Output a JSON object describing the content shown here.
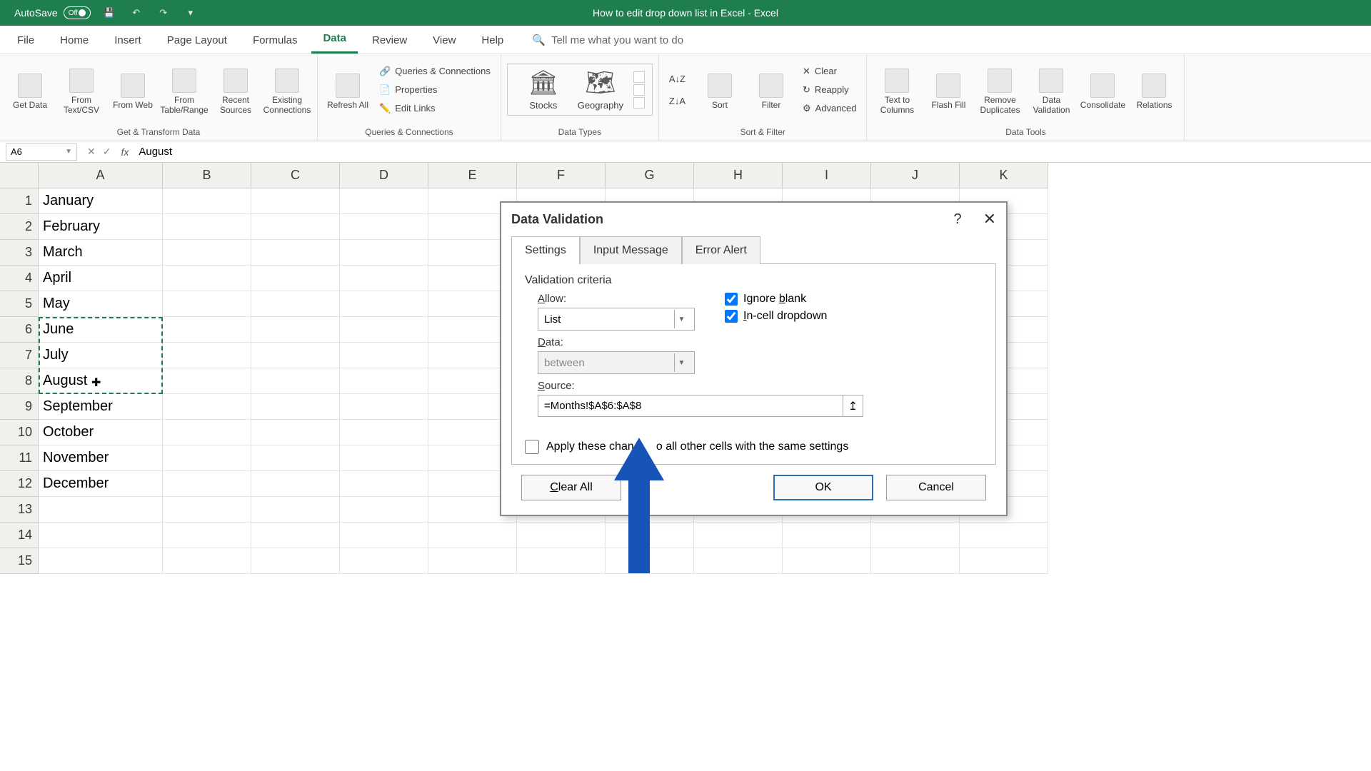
{
  "titlebar": {
    "autosave": "AutoSave",
    "toggle": "Off",
    "title": "How to edit drop down list in Excel  -  Excel"
  },
  "tabs": {
    "file": "File",
    "home": "Home",
    "insert": "Insert",
    "page_layout": "Page Layout",
    "formulas": "Formulas",
    "data": "Data",
    "review": "Review",
    "view": "View",
    "help": "Help",
    "search": "Tell me what you want to do"
  },
  "ribbon": {
    "get_transform": {
      "label": "Get & Transform Data",
      "get_data": "Get Data",
      "from_text": "From Text/CSV",
      "from_web": "From Web",
      "from_table": "From Table/Range",
      "recent": "Recent Sources",
      "existing": "Existing Connections"
    },
    "queries": {
      "label": "Queries & Connections",
      "refresh": "Refresh All",
      "qc": "Queries & Connections",
      "props": "Properties",
      "edit": "Edit Links"
    },
    "types": {
      "label": "Data Types",
      "stocks": "Stocks",
      "geo": "Geography"
    },
    "sort": {
      "label": "Sort & Filter",
      "sort": "Sort",
      "filter": "Filter",
      "clear": "Clear",
      "reapply": "Reapply",
      "advanced": "Advanced"
    },
    "tools": {
      "label": "Data Tools",
      "text_cols": "Text to Columns",
      "flash": "Flash Fill",
      "remove_dup": "Remove Duplicates",
      "validation": "Data Validation",
      "consolidate": "Consolidate",
      "relations": "Relations"
    }
  },
  "namebox": "A6",
  "formula": "August",
  "cols": [
    "A",
    "B",
    "C",
    "D",
    "E",
    "F",
    "G",
    "H",
    "I",
    "J",
    "K"
  ],
  "rows": [
    "1",
    "2",
    "3",
    "4",
    "5",
    "6",
    "7",
    "8",
    "9",
    "10",
    "11",
    "12",
    "13",
    "14",
    "15"
  ],
  "cells": {
    "a1": "January",
    "a2": "February",
    "a3": "March",
    "a4": "April",
    "a5": "May",
    "a6": "June",
    "a7": "July",
    "a8": "August",
    "a9": "September",
    "a10": "October",
    "a11": "November",
    "a12": "December"
  },
  "dialog": {
    "title": "Data Validation",
    "tab_settings": "Settings",
    "tab_input": "Input Message",
    "tab_error": "Error Alert",
    "criteria": "Validation criteria",
    "allow_label": "Allow:",
    "allow_value": "List",
    "data_label": "Data:",
    "data_value": "between",
    "ignore_blank": "Ignore blank",
    "incell": "In-cell dropdown",
    "source_label": "Source:",
    "source_value": "=Months!$A$6:$A$8",
    "apply": "Apply these changes to all other cells with the same settings",
    "clear": "Clear All",
    "ok": "OK",
    "cancel": "Cancel"
  }
}
